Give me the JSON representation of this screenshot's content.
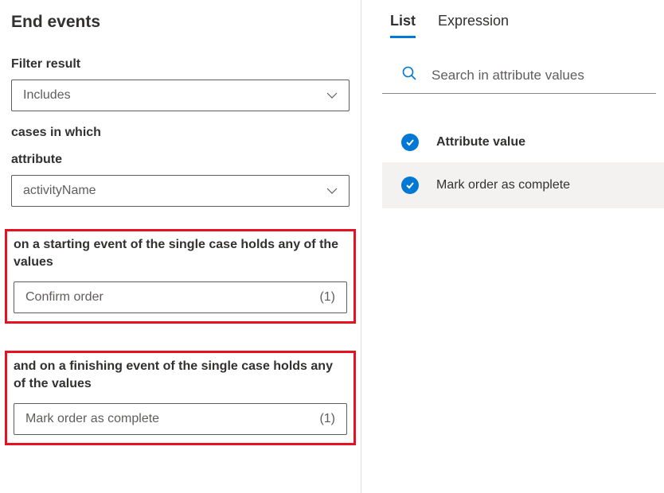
{
  "page": {
    "title": "End events"
  },
  "filterResult": {
    "label": "Filter result",
    "value": "Includes"
  },
  "casesText": "cases in which",
  "attribute": {
    "label": "attribute",
    "value": "activityName"
  },
  "startingEvent": {
    "label": "on a starting event of the single case holds any of the values",
    "value": "Confirm order",
    "count": "(1)"
  },
  "finishingEvent": {
    "label": "and on a finishing event of the single case holds any of the values",
    "value": "Mark order as complete",
    "count": "(1)"
  },
  "tabs": {
    "list": "List",
    "expression": "Expression"
  },
  "search": {
    "placeholder": "Search in attribute values"
  },
  "attrList": {
    "header": "Attribute value",
    "items": [
      {
        "label": "Mark order as complete"
      }
    ]
  }
}
